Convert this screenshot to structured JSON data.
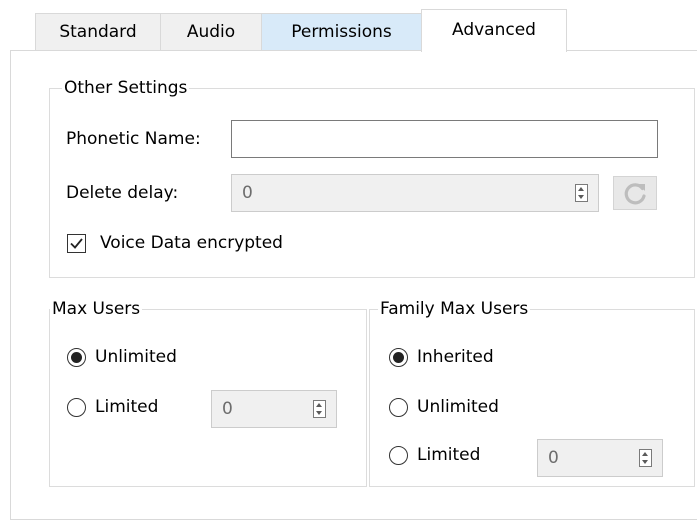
{
  "tabs": [
    {
      "label": "Standard",
      "state": "normal"
    },
    {
      "label": "Audio",
      "state": "normal"
    },
    {
      "label": "Permissions",
      "state": "hover"
    },
    {
      "label": "Advanced",
      "state": "selected"
    }
  ],
  "other_settings": {
    "title": "Other Settings",
    "phonetic_name_label": "Phonetic Name:",
    "phonetic_name_value": "",
    "delete_delay_label": "Delete delay:",
    "delete_delay_value": "0",
    "refresh_icon": "refresh-icon",
    "voice_encrypted_label": "Voice Data encrypted",
    "voice_encrypted_checked": true
  },
  "max_users": {
    "title": "Max Users",
    "unlimited_label": "Unlimited",
    "limited_label": "Limited",
    "limited_value": "0",
    "selected": "Unlimited"
  },
  "family_max_users": {
    "title": "Family Max Users",
    "inherited_label": "Inherited",
    "unlimited_label": "Unlimited",
    "limited_label": "Limited",
    "limited_value": "0",
    "selected": "Inherited"
  },
  "colors": {
    "tab_hover": "#d8eaf9",
    "border": "#d9d9d9",
    "disabled_field": "#f0f0f0"
  }
}
